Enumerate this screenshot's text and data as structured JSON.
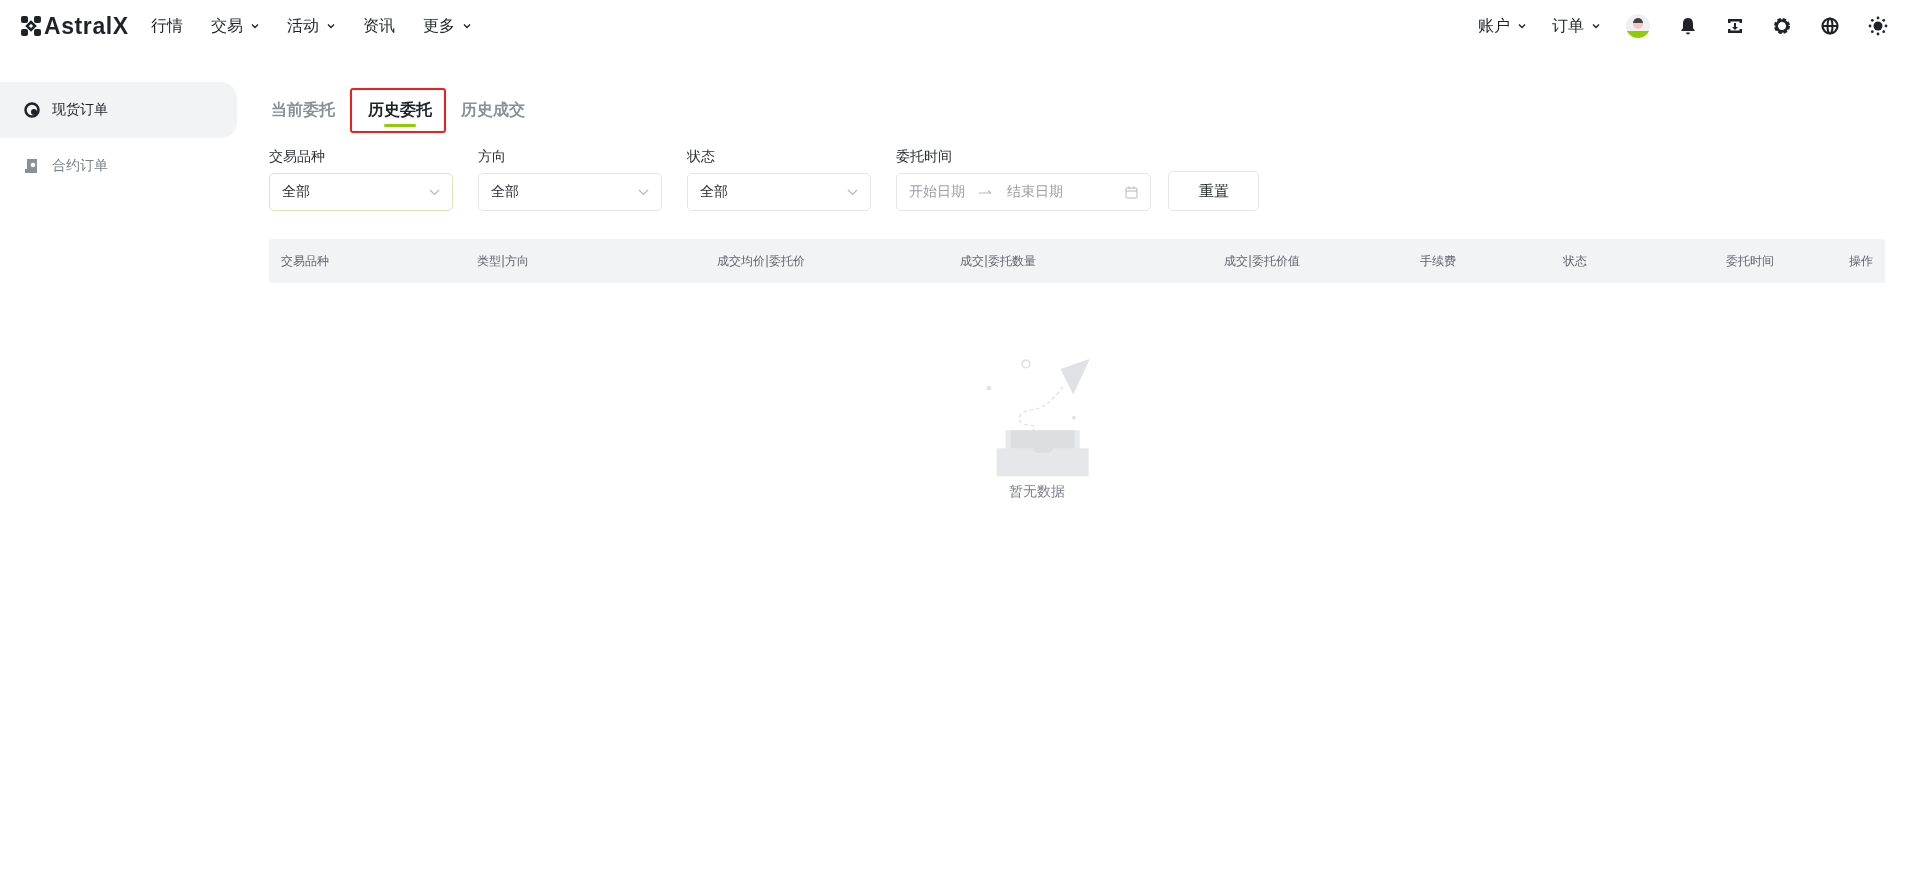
{
  "header": {
    "logo": "AstralX",
    "nav": [
      {
        "label": "行情",
        "dropdown": false
      },
      {
        "label": "交易",
        "dropdown": true
      },
      {
        "label": "活动",
        "dropdown": true
      },
      {
        "label": "资讯",
        "dropdown": false
      },
      {
        "label": "更多",
        "dropdown": true
      }
    ],
    "right_nav": [
      {
        "label": "账户",
        "dropdown": true
      },
      {
        "label": "订单",
        "dropdown": true
      }
    ]
  },
  "sidebar": {
    "items": [
      {
        "label": "现货订单",
        "kind": "spot",
        "selected": true
      },
      {
        "label": "合约订单",
        "kind": "contract",
        "selected": false
      }
    ]
  },
  "tabs": [
    {
      "label": "当前委托",
      "selected": false,
      "highlighted": false
    },
    {
      "label": "历史委托",
      "selected": true,
      "highlighted": true
    },
    {
      "label": "历史成交",
      "selected": false,
      "highlighted": false
    }
  ],
  "filters": [
    {
      "label": "交易品种",
      "kind": "select",
      "value": "全部",
      "focused": true
    },
    {
      "label": "方向",
      "kind": "select",
      "value": "全部",
      "focused": false
    },
    {
      "label": "状态",
      "kind": "select",
      "value": "全部",
      "focused": false
    },
    {
      "label": "委托时间",
      "kind": "daterange",
      "start_placeholder": "开始日期",
      "end_placeholder": "结束日期"
    }
  ],
  "reset_button": "重置",
  "table": {
    "columns": [
      "交易品种",
      "类型|方向",
      "成交均价|委托价",
      "成交|委托数量",
      "成交|委托价值",
      "手续费",
      "状态",
      "委托时间",
      "操作"
    ],
    "empty_text": "暂无数据"
  }
}
